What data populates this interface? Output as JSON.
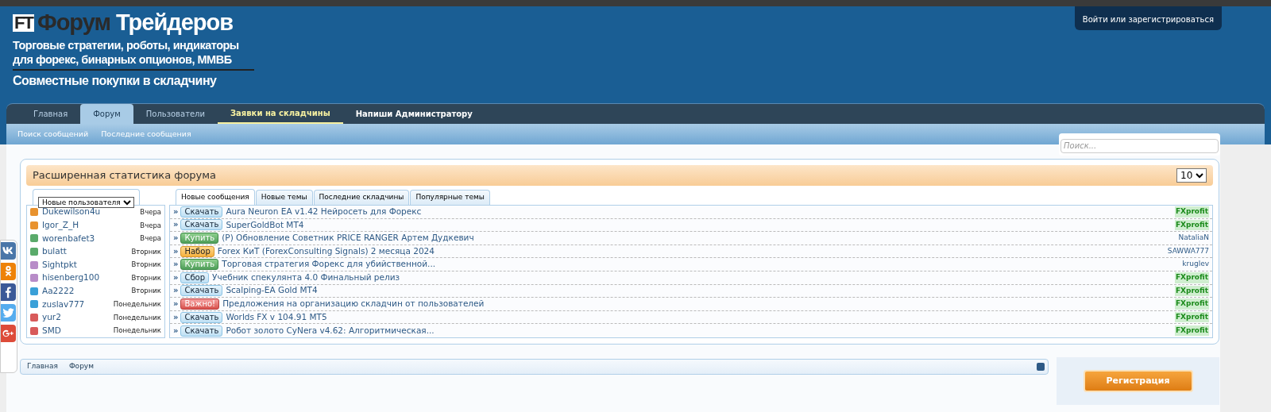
{
  "header": {
    "logo_mark": "FT",
    "title_dark": "Форум",
    "title_light": "Трейдеров",
    "tagline_1": "Торговые стратегии, роботы, индикаторы",
    "tagline_2": "для форекс, бинарных опционов, ММВБ",
    "tagline_3": "Совместные покупки в складчину",
    "login": "Войти или зарегистрироваться"
  },
  "nav": [
    {
      "label": "Главная",
      "selected": false,
      "highlighted": false
    },
    {
      "label": "Форум",
      "selected": true,
      "highlighted": false
    },
    {
      "label": "Пользователи",
      "selected": false,
      "highlighted": false
    },
    {
      "label": "Заявки на складчины",
      "selected": false,
      "highlighted": true
    },
    {
      "label": "Напиши Администратору",
      "selected": false,
      "highlighted": false
    }
  ],
  "subnav": [
    "Поиск сообщений",
    "Последние сообщения"
  ],
  "search": {
    "placeholder": "Поиск..."
  },
  "stats": {
    "title": "Расширенная статистика форума",
    "limit": "10",
    "users_select": "Новые пользователя",
    "users": [
      {
        "name": "Dukewilson4u",
        "when": "Вчера",
        "color": "#e8922e"
      },
      {
        "name": "Igor_Z_H",
        "when": "Вчера",
        "color": "#e8922e"
      },
      {
        "name": "worenbafet3",
        "when": "Вчера",
        "color": "#5aaa6a"
      },
      {
        "name": "bulatt",
        "when": "Вторник",
        "color": "#5aaa6a"
      },
      {
        "name": "Sightpkt",
        "when": "Вторник",
        "color": "#b88cc8"
      },
      {
        "name": "hisenberg100",
        "when": "Вторник",
        "color": "#b88cc8"
      },
      {
        "name": "Aa2222",
        "when": "Вторник",
        "color": "#3aa0d8"
      },
      {
        "name": "zuslav777",
        "when": "Понедельник",
        "color": "#3aa0d8"
      },
      {
        "name": "yur2",
        "when": "Понедельник",
        "color": "#d85a5a"
      },
      {
        "name": "SMD",
        "when": "Понедельник",
        "color": "#d85a5a"
      }
    ],
    "tabs": [
      {
        "label": "Новые сообщения",
        "selected": true
      },
      {
        "label": "Новые темы",
        "selected": false
      },
      {
        "label": "Последние складчины",
        "selected": false
      },
      {
        "label": "Популярные темы",
        "selected": false
      }
    ],
    "topics": [
      {
        "bullet": "»",
        "kind": "download",
        "prefix": "Скачать",
        "title": "Aura Neuron EA v1.42 Нейросеть для Форекс",
        "author": "FXprofit",
        "author_highlighted": true
      },
      {
        "bullet": "»",
        "kind": "download",
        "prefix": "Скачать",
        "title": "SuperGoldBot MT4",
        "author": "FXprofit",
        "author_highlighted": true
      },
      {
        "bullet": "»",
        "kind": "buy",
        "prefix": "Купить",
        "title": "(P) Обновление Советник PRICE RANGER Артем Дудкевич",
        "author": "NataliaN",
        "author_highlighted": false
      },
      {
        "bullet": "»",
        "kind": "recruit",
        "prefix": "Набор",
        "title": "Forex КиТ (ForexConsulting Signals) 2 месяца 2024",
        "author": "SAWWA777",
        "author_highlighted": false
      },
      {
        "bullet": "»",
        "kind": "buy",
        "prefix": "Купить",
        "title": "Торговая стратегия Форекс для убийственной...",
        "author": "kruglev",
        "author_highlighted": false
      },
      {
        "bullet": "»",
        "kind": "collect",
        "prefix": "Сбор",
        "title": "Учебник спекулянта 4.0 Финальный релиз",
        "author": "FXprofit",
        "author_highlighted": true
      },
      {
        "bullet": "»",
        "kind": "download",
        "prefix": "Скачать",
        "title": "Scalping-EA Gold MT4",
        "author": "FXprofit",
        "author_highlighted": true
      },
      {
        "bullet": "»",
        "kind": "important",
        "prefix": "Важно!",
        "title": "Предложения на организацию складчин от пользователей",
        "author": "FXprofit",
        "author_highlighted": true
      },
      {
        "bullet": "»",
        "kind": "download",
        "prefix": "Скачать",
        "title": "Worlds FX v 104.91 MT5",
        "author": "FXprofit",
        "author_highlighted": true
      },
      {
        "bullet": "»",
        "kind": "download",
        "prefix": "Скачать",
        "title": "Робот золото CyNera v4.62: Алгоритмическая...",
        "author": "FXprofit",
        "author_highlighted": true
      }
    ]
  },
  "breadcrumbs": [
    "Главная",
    "Форум"
  ],
  "register_button": "Регистрация"
}
